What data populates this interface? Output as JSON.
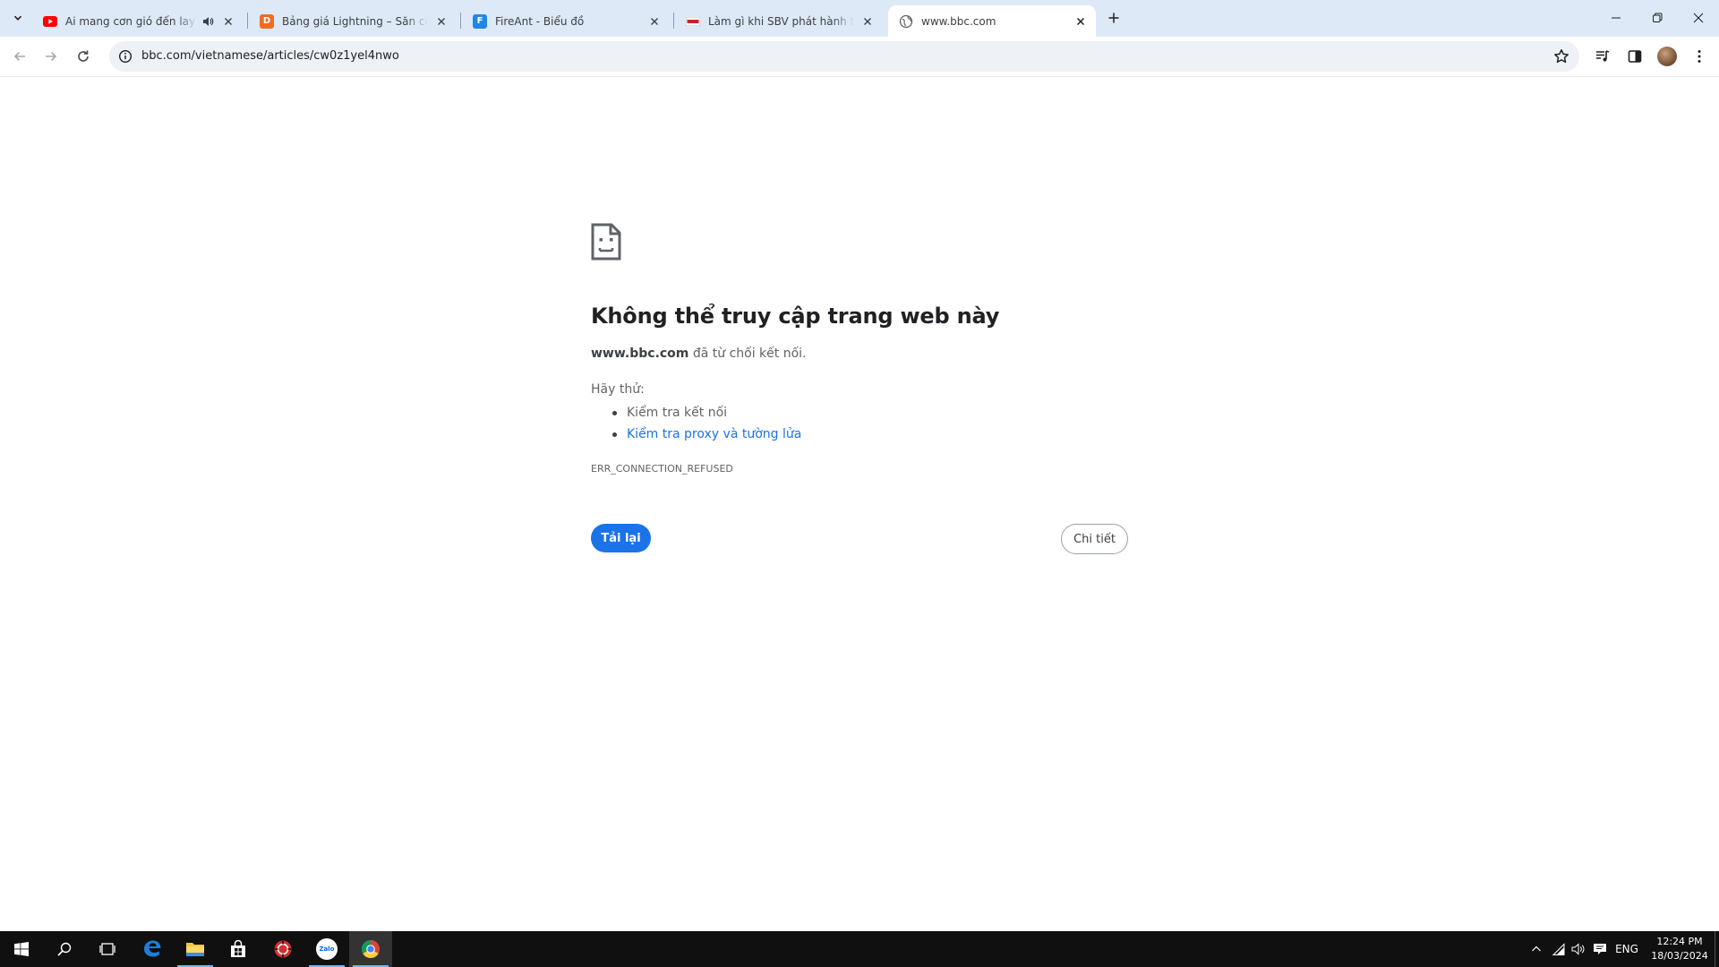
{
  "tabs": [
    {
      "title": "Ai mang cơn gió đến lay cành cây",
      "favicon": "youtube-icon",
      "audio": true
    },
    {
      "title": "Bảng giá Lightning – Săn cổ phiếu",
      "favicon": "dnse-icon"
    },
    {
      "title": "FireAnt - Biểu đồ",
      "favicon": "fireant-icon"
    },
    {
      "title": "Làm gì khi SBV phát hành tín phiếu",
      "favicon": "news-icon"
    },
    {
      "title": "www.bbc.com",
      "favicon": "globe-icon",
      "active": true
    }
  ],
  "address_bar": {
    "url": "bbc.com/vietnamese/articles/cw0z1yel4nwo"
  },
  "error": {
    "title": "Không thể truy cập trang web này",
    "host": "www.bbc.com",
    "message": " đã từ chối kết nối.",
    "try_label": "Hãy thử:",
    "suggestions": [
      "Kiểm tra kết nối",
      "Kiểm tra proxy và tường lửa"
    ],
    "code": "ERR_CONNECTION_REFUSED",
    "reload_label": "Tải lại",
    "details_label": "Chi tiết"
  },
  "taskbar": {
    "language": "ENG",
    "time": "12:24 PM",
    "date": "18/03/2024",
    "zalo_label": "Zalo"
  },
  "colors": {
    "accent": "#1a73e8",
    "tabstrip": "#dee9f7",
    "taskbar": "#101010"
  }
}
